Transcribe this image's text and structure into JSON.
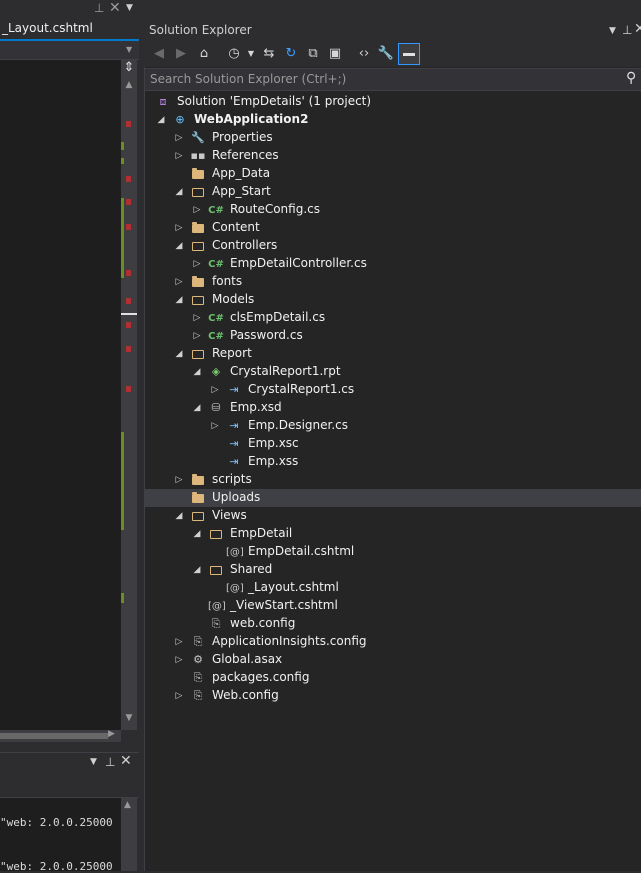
{
  "editor": {
    "tab_label": "_Layout.cshtml",
    "pin_glyph": "⊥",
    "close_glyph": "✕",
    "dropdown_glyph": "▼"
  },
  "output": {
    "lines": [
      "\"web: 2.0.0.25000",
      "\"web: 2.0.0.25000"
    ]
  },
  "solution_explorer": {
    "title": "Solution Explorer",
    "search_placeholder": "Search Solution Explorer (Ctrl+;)",
    "toolbar_icons": [
      "back-icon",
      "forward-icon",
      "home-icon",
      "history-icon",
      "sync-icon",
      "refresh-icon",
      "collapse-all-icon",
      "show-all-files-icon",
      "code-view-icon",
      "properties-icon",
      "preview-selected-icon"
    ],
    "tree": [
      {
        "label": "Solution 'EmpDetails' (1 project)",
        "icon": "solution-icon",
        "level": 0,
        "expander": "none"
      },
      {
        "label": "WebApplication2",
        "icon": "web-project-icon",
        "level": 0,
        "expander": "expanded",
        "bold": true
      },
      {
        "label": "Properties",
        "icon": "wrench-icon",
        "level": 1,
        "expander": "collapsed"
      },
      {
        "label": "References",
        "icon": "references-icon",
        "level": 1,
        "expander": "collapsed"
      },
      {
        "label": "App_Data",
        "icon": "folder-icon",
        "level": 1,
        "expander": "none"
      },
      {
        "label": "App_Start",
        "icon": "folder-open-icon",
        "level": 1,
        "expander": "expanded"
      },
      {
        "label": "RouteConfig.cs",
        "icon": "csharp-file-icon",
        "level": 2,
        "expander": "collapsed"
      },
      {
        "label": "Content",
        "icon": "folder-icon",
        "level": 1,
        "expander": "collapsed"
      },
      {
        "label": "Controllers",
        "icon": "folder-open-icon",
        "level": 1,
        "expander": "expanded"
      },
      {
        "label": "EmpDetailController.cs",
        "icon": "csharp-file-icon",
        "level": 2,
        "expander": "collapsed"
      },
      {
        "label": "fonts",
        "icon": "folder-icon",
        "level": 1,
        "expander": "collapsed"
      },
      {
        "label": "Models",
        "icon": "folder-open-icon",
        "level": 1,
        "expander": "expanded"
      },
      {
        "label": "clsEmpDetail.cs",
        "icon": "csharp-file-icon",
        "level": 2,
        "expander": "collapsed"
      },
      {
        "label": "Password.cs",
        "icon": "csharp-file-icon",
        "level": 2,
        "expander": "collapsed"
      },
      {
        "label": "Report",
        "icon": "folder-open-icon",
        "level": 1,
        "expander": "expanded"
      },
      {
        "label": "CrystalReport1.rpt",
        "icon": "crystal-report-icon",
        "level": 2,
        "expander": "expanded"
      },
      {
        "label": "CrystalReport1.cs",
        "icon": "designer-file-icon",
        "level": 3,
        "expander": "collapsed"
      },
      {
        "label": "Emp.xsd",
        "icon": "dataset-icon",
        "level": 2,
        "expander": "expanded"
      },
      {
        "label": "Emp.Designer.cs",
        "icon": "designer-file-icon",
        "level": 3,
        "expander": "collapsed"
      },
      {
        "label": "Emp.xsc",
        "icon": "designer-file-icon",
        "level": 3,
        "expander": "none"
      },
      {
        "label": "Emp.xss",
        "icon": "designer-file-icon",
        "level": 3,
        "expander": "none"
      },
      {
        "label": "scripts",
        "icon": "folder-icon",
        "level": 1,
        "expander": "collapsed"
      },
      {
        "label": "Uploads",
        "icon": "folder-icon",
        "level": 1,
        "expander": "none",
        "selected": true
      },
      {
        "label": "Views",
        "icon": "folder-open-icon",
        "level": 1,
        "expander": "expanded"
      },
      {
        "label": "EmpDetail",
        "icon": "folder-open-icon",
        "level": 2,
        "expander": "expanded"
      },
      {
        "label": "EmpDetail.cshtml",
        "icon": "razor-file-icon",
        "level": 3,
        "expander": "none"
      },
      {
        "label": "Shared",
        "icon": "folder-open-icon",
        "level": 2,
        "expander": "expanded"
      },
      {
        "label": "_Layout.cshtml",
        "icon": "razor-file-icon",
        "level": 3,
        "expander": "none"
      },
      {
        "label": "_ViewStart.cshtml",
        "icon": "razor-file-icon",
        "level": 2,
        "expander": "none"
      },
      {
        "label": "web.config",
        "icon": "config-file-icon",
        "level": 2,
        "expander": "none"
      },
      {
        "label": "ApplicationInsights.config",
        "icon": "config-file-icon",
        "level": 1,
        "expander": "collapsed"
      },
      {
        "label": "Global.asax",
        "icon": "global-asax-icon",
        "level": 1,
        "expander": "collapsed"
      },
      {
        "label": "packages.config",
        "icon": "config-file-icon",
        "level": 1,
        "expander": "none"
      },
      {
        "label": "Web.config",
        "icon": "config-file-icon",
        "level": 1,
        "expander": "collapsed"
      }
    ]
  }
}
